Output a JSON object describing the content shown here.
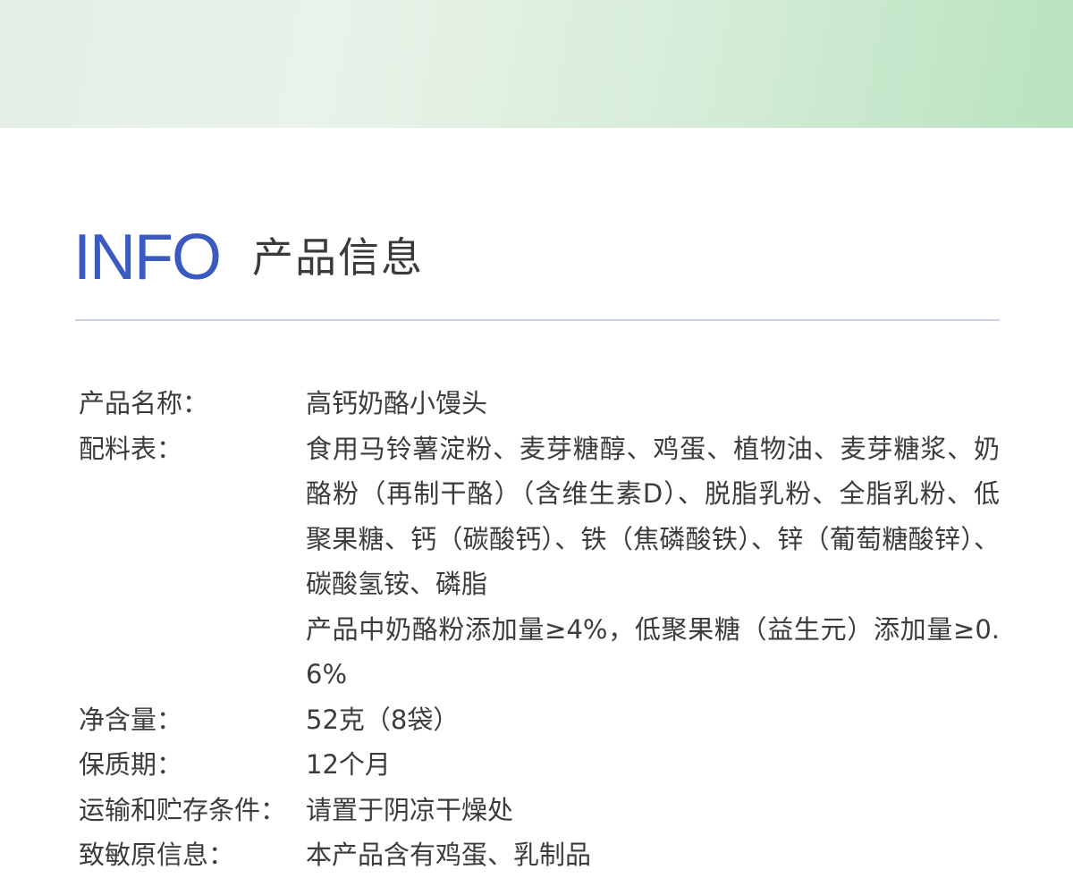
{
  "header": {
    "title_en": "INFO",
    "title_cn": "产品信息"
  },
  "info": [
    {
      "label": "产品名称：",
      "value": [
        "高钙奶酪小馒头"
      ]
    },
    {
      "label": "配料表：",
      "value": [
        "食用马铃薯淀粉、麦芽糖醇、鸡蛋、植物油、麦芽糖浆、奶酪粉（再制干酪）（含维生素D）、脱脂乳粉、全脂乳粉、低聚果糖、钙（碳酸钙）、铁（焦磷酸铁）、锌（葡萄糖酸锌）、碳酸氢铵、磷脂",
        "产品中奶酪粉添加量≥4%，低聚果糖（益生元）添加量≥0.6%"
      ]
    },
    {
      "label": "净含量：",
      "value": [
        "52克（8袋）"
      ]
    },
    {
      "label": "保质期：",
      "value": [
        "12个月"
      ]
    },
    {
      "label": "运输和贮存条件：",
      "value": [
        "请置于阴凉干燥处"
      ]
    },
    {
      "label": "致敏原信息：",
      "value": [
        "本产品含有鸡蛋、乳制品"
      ]
    }
  ],
  "colors": {
    "accent": "#3a5ac2",
    "text": "#3c3c3c",
    "divider": "#c8d1dc",
    "band_light": "#e9f3ea",
    "band_green": "#b8e3bf"
  }
}
